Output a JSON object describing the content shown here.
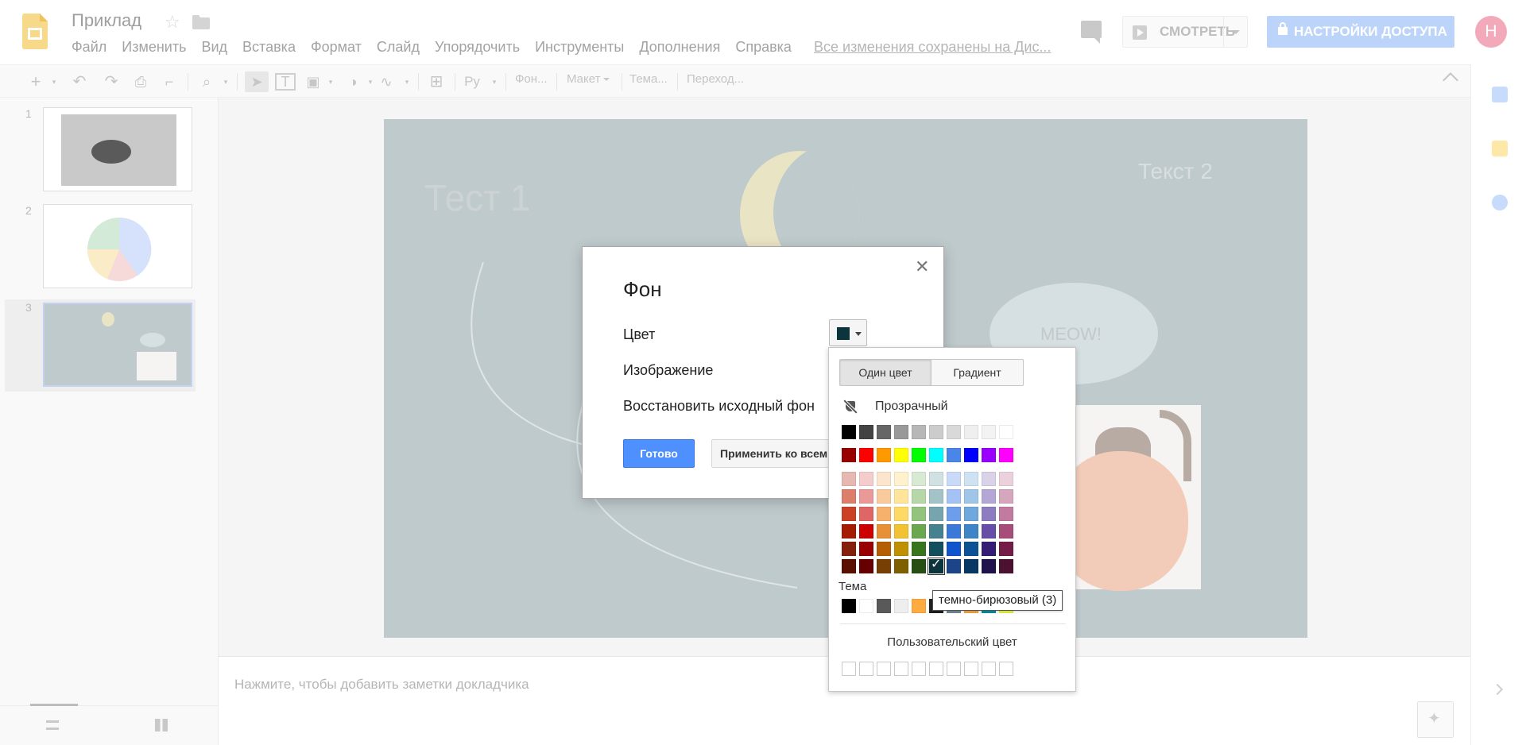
{
  "header": {
    "title": "Приклад",
    "menu": [
      "Файл",
      "Изменить",
      "Вид",
      "Вставка",
      "Формат",
      "Слайд",
      "Упорядочить",
      "Инструменты",
      "Дополнения",
      "Справка"
    ],
    "save_status": "Все изменения сохранены на Дис...",
    "present_label": "СМОТРЕТЬ",
    "share_label": "НАСТРОЙКИ ДОСТУПА",
    "avatar_letter": "Н"
  },
  "toolbar": {
    "background_label": "Фон...",
    "layout_label": "Макет",
    "theme_label": "Тема...",
    "transition_label": "Переход...",
    "input_tools_label": "Ру"
  },
  "filmstrip": {
    "slides": [
      {
        "number": "1"
      },
      {
        "number": "2"
      },
      {
        "number": "3"
      }
    ]
  },
  "slide": {
    "title1": "Тест 1",
    "title2": "Текст 2",
    "bubble_text": "MEOW!"
  },
  "notes": {
    "placeholder": "Нажмите, чтобы добавить заметки докладчика"
  },
  "dialog": {
    "title": "Фон",
    "color_label": "Цвет",
    "image_label": "Изображение",
    "reset_label": "Восстановить исходный фон",
    "done_label": "Готово",
    "apply_all_label": "Применить ко всем",
    "current_color": "#0c343d"
  },
  "palette": {
    "tab_solid": "Один цвет",
    "tab_gradient": "Градиент",
    "transparent_label": "Прозрачный",
    "theme_label": "Тема",
    "custom_label": "Пользовательский цвет",
    "tooltip": "темно-бирюзовый (3)",
    "grays": [
      "#000000",
      "#434343",
      "#666666",
      "#999999",
      "#b7b7b7",
      "#cccccc",
      "#d9d9d9",
      "#efefef",
      "#f3f3f3",
      "#ffffff"
    ],
    "brights": [
      "#980000",
      "#ff0000",
      "#ff9900",
      "#ffff00",
      "#00ff00",
      "#00ffff",
      "#4a86e8",
      "#0000ff",
      "#9900ff",
      "#ff00ff"
    ],
    "shades": [
      [
        "#e6b8af",
        "#f4cccc",
        "#fce5cd",
        "#fff2cc",
        "#d9ead3",
        "#d0e0e3",
        "#c9daf8",
        "#cfe2f3",
        "#d9d2e9",
        "#ead1dc"
      ],
      [
        "#dd7e6b",
        "#ea9999",
        "#f9cb9c",
        "#ffe599",
        "#b6d7a8",
        "#a2c4c9",
        "#a4c2f4",
        "#9fc5e8",
        "#b4a7d6",
        "#d5a6bd"
      ],
      [
        "#cc4125",
        "#e06666",
        "#f6b26b",
        "#ffd966",
        "#93c47d",
        "#76a5af",
        "#6d9eeb",
        "#6fa8dc",
        "#8e7cc3",
        "#c27ba0"
      ],
      [
        "#a61c00",
        "#cc0000",
        "#e69138",
        "#f1c232",
        "#6aa84f",
        "#45818e",
        "#3c78d8",
        "#3d85c6",
        "#674ea7",
        "#a64d79"
      ],
      [
        "#85200c",
        "#990000",
        "#b45f06",
        "#bf9000",
        "#38761d",
        "#134f5c",
        "#1155cc",
        "#0b5394",
        "#351c75",
        "#741b47"
      ],
      [
        "#5b0f00",
        "#660000",
        "#783f04",
        "#7f6000",
        "#274e13",
        "#0c343d",
        "#1c4587",
        "#073763",
        "#20124d",
        "#4c1130"
      ]
    ],
    "theme_colors": [
      "#000000",
      "#ffffff",
      "#595959",
      "#eeeeee",
      "#ffab40",
      "#212121",
      "#78909c",
      "#ffab40",
      "#0097a7",
      "#eeff41"
    ],
    "custom_slots": 10
  }
}
